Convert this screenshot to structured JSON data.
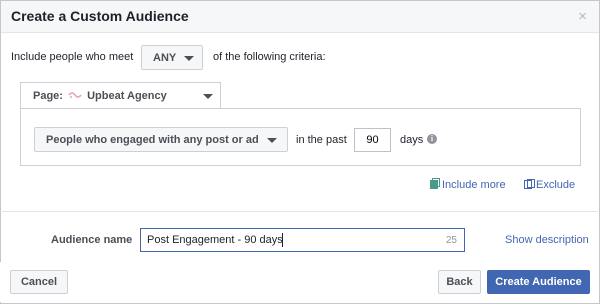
{
  "dialog": {
    "title": "Create a Custom Audience",
    "close_glyph": "×"
  },
  "criteria": {
    "prefix": "Include people who meet",
    "match_selected": "ANY",
    "suffix": "of the following criteria:"
  },
  "source": {
    "label_prefix": "Page:",
    "page_name": "Upbeat Agency",
    "icon": "page-logo-icon"
  },
  "rule": {
    "event_selected": "People who engaged with any post or ad",
    "in_the_past": "in the past",
    "days_value": "90",
    "days_label": "days",
    "info_glyph": "i"
  },
  "actions": {
    "include_more": "Include more",
    "exclude": "Exclude"
  },
  "audience": {
    "label": "Audience name",
    "value": "Post Engagement - 90 days",
    "remaining_count": "25",
    "show_description": "Show description"
  },
  "footer": {
    "cancel": "Cancel",
    "back": "Back",
    "create": "Create Audience"
  },
  "colors": {
    "link": "#4267b2",
    "primary": "#4267b2"
  }
}
